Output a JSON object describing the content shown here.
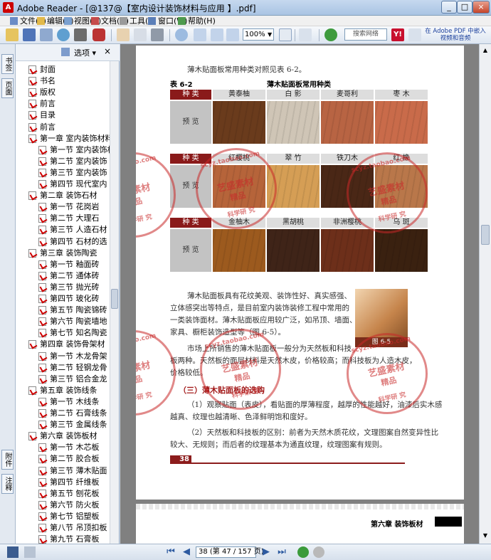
{
  "window": {
    "title": "Adobe Reader - [@137@【室内设计装饰材料与应用 】.pdf]",
    "controls": [
      "_",
      "□",
      "×"
    ]
  },
  "menu": [
    {
      "label": "文件(F)",
      "icon": "file-icon"
    },
    {
      "label": "编辑(E)",
      "icon": "edit-icon"
    },
    {
      "label": "视图(V)",
      "icon": "view-icon"
    },
    {
      "label": "文档(D)",
      "icon": "document-icon"
    },
    {
      "label": "工具(T)",
      "icon": "tools-icon"
    },
    {
      "label": "窗口(W)",
      "icon": "window-icon"
    },
    {
      "label": "帮助(H)",
      "icon": "help-icon"
    }
  ],
  "toolbar": {
    "zoom": "100%",
    "search_placeholder": "搜索网络",
    "promo": "在 Adobe PDF 中嵌入视频和音频"
  },
  "side_tabs": {
    "top": [
      "书签",
      "页面"
    ],
    "bottom": [
      "附件",
      "注释"
    ]
  },
  "bookmarks": {
    "options_label": "选项",
    "close": "×",
    "items": [
      {
        "label": "封面",
        "level": 0
      },
      {
        "label": "书名",
        "level": 0
      },
      {
        "label": "版权",
        "level": 0
      },
      {
        "label": "前言",
        "level": 0
      },
      {
        "label": "目录",
        "level": 0
      },
      {
        "label": "前言",
        "level": 0
      },
      {
        "label": "第一章  室内装饰材料",
        "level": 0
      },
      {
        "label": "第一节  室内装饰材",
        "level": 1
      },
      {
        "label": "第二节  室内装饰",
        "level": 1
      },
      {
        "label": "第三节  室内装饰",
        "level": 1
      },
      {
        "label": "第四节  现代室内",
        "level": 1
      },
      {
        "label": "第二章  装饰石材",
        "level": 0
      },
      {
        "label": "第一节  花岗岩",
        "level": 1
      },
      {
        "label": "第二节  大理石",
        "level": 1
      },
      {
        "label": "第三节  人造石材",
        "level": 1
      },
      {
        "label": "第四节  石材的选",
        "level": 1
      },
      {
        "label": "第三章  装饰陶瓷",
        "level": 0
      },
      {
        "label": "第一节  釉面砖",
        "level": 1
      },
      {
        "label": "第二节  通体砖",
        "level": 1
      },
      {
        "label": "第三节  抛光砖",
        "level": 1
      },
      {
        "label": "第四节  玻化砖",
        "level": 1
      },
      {
        "label": "第五节  陶瓷锦砖",
        "level": 1
      },
      {
        "label": "第六节  陶瓷墙地",
        "level": 1
      },
      {
        "label": "第七节  知名陶瓷",
        "level": 1
      },
      {
        "label": "第四章  装饰骨架材",
        "level": 0
      },
      {
        "label": "第一节  木龙骨架",
        "level": 1
      },
      {
        "label": "第二节  轻钢龙骨",
        "level": 1
      },
      {
        "label": "第三节  铝合金龙",
        "level": 1
      },
      {
        "label": "第五章  装饰线条",
        "level": 0
      },
      {
        "label": "第一节  木线条",
        "level": 1
      },
      {
        "label": "第二节  石膏线条",
        "level": 1
      },
      {
        "label": "第三节  金属线条",
        "level": 1
      },
      {
        "label": "第六章  装饰板材",
        "level": 0
      },
      {
        "label": "第一节  木芯板",
        "level": 1
      },
      {
        "label": "第二节  胶合板",
        "level": 1
      },
      {
        "label": "第三节  薄木贴面",
        "level": 1
      },
      {
        "label": "第四节  纤维板",
        "level": 1
      },
      {
        "label": "第五节  刨花板",
        "level": 1
      },
      {
        "label": "第六节  防火板",
        "level": 1
      },
      {
        "label": "第七节  铝塑板",
        "level": 1
      },
      {
        "label": "第八节  吊顶扣板",
        "level": 1
      },
      {
        "label": "第九节  石膏板",
        "level": 1
      }
    ]
  },
  "page": {
    "intro": "薄木贴面板常用种类对照见表 6-2。",
    "table_no": "表 6-2",
    "table_title": "薄木贴面板常用种类",
    "header_kind": "种 类",
    "row_preview": "预 览",
    "groups": [
      {
        "names": [
          "黄泰柚",
          "白 影",
          "麦哥利",
          "枣 木"
        ],
        "colors": [
          "#6a3b1c",
          "#cfc5b6",
          "#b86443",
          "#c96b4a"
        ]
      },
      {
        "names": [
          "红樱桃",
          "翠 竹",
          "铁刀木",
          "红 橡"
        ],
        "colors": [
          "#b6643a",
          "#d59e55",
          "#4a2716",
          "#b9774a"
        ]
      },
      {
        "names": [
          "金柚木",
          "黑胡桃",
          "非洲樱桃",
          "乌 斑"
        ],
        "colors": [
          "#9c5a1e",
          "#3f2418",
          "#6d2f1a",
          "#3a2110"
        ]
      }
    ],
    "para1": [
      "薄木贴面板具有花纹美观、装饰性好、真实感强、",
      "立体感突出等特点，是目前室内装饰装修工程中常用的",
      "一类装饰面材。薄木贴面板应用较广泛，如吊顶、墙面、",
      "家具、橱柜装饰造型等（图 6-5）。"
    ],
    "fig_caption": "图 6-5",
    "para2": [
      "市场上所销售的薄木贴面板一般分为天然板和科技",
      "板两种。天然板的面层材料是天然木皮，价格较高；而科技板为人造木皮，",
      "价格较低。"
    ],
    "section_title": "（三）薄木贴面板的选购",
    "para3": [
      "（1）观察贴面（表皮），看贴面的厚薄程度，越厚的性能越好，油漆后实木感",
      "越真、纹理也越清晰、色泽鲜明饱和度好。",
      "（2）天然板和科技板的区别：前者为天然木质花纹，文理图案自然变异性比",
      "较大、无规则；而后者的纹理基本为通直纹理，纹理图案有规则。"
    ],
    "page_number": "38",
    "next_header": "第六章  装饰板材"
  },
  "watermarks": [
    {
      "arc": "scyz.taobao.com",
      "line1": "艺盛素材",
      "line2": "精品",
      "bottom": "科学研 究"
    }
  ],
  "status": {
    "page_display": "38 (第 47 / 157 页)"
  }
}
